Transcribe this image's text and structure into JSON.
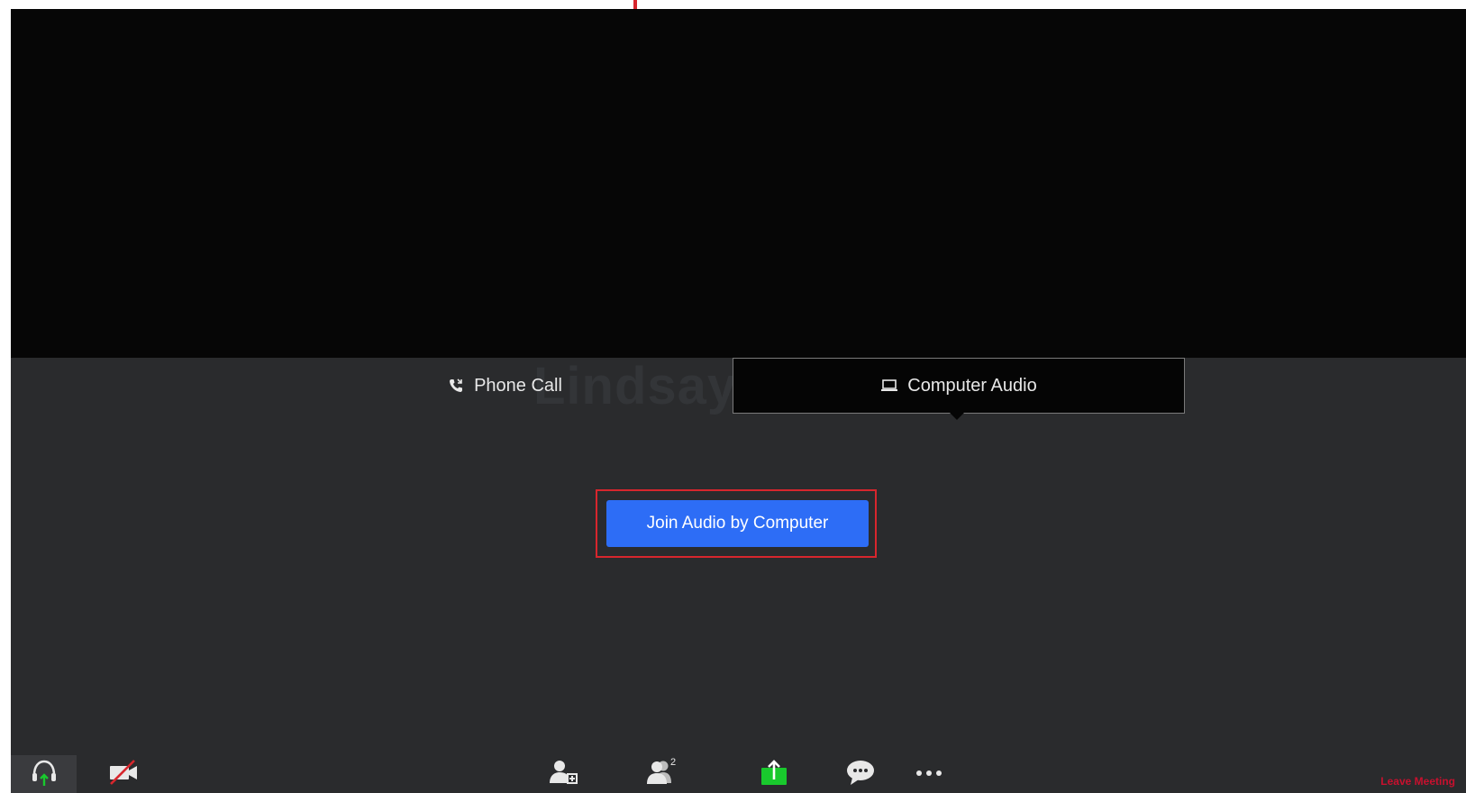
{
  "participant": {
    "name": "Lindsay"
  },
  "audio_tabs": {
    "phone_label": "Phone Call",
    "computer_label": "Computer Audio",
    "selected": "Computer Audio"
  },
  "join_button": {
    "label": "Join Audio by Computer"
  },
  "toolbar": {
    "participants_count": "2",
    "leave_label": "Leave Meeting"
  },
  "colors": {
    "accent": "#2d6df6",
    "highlight": "#d7262d",
    "share_green": "#19c92d",
    "leave_red": "#c8102e",
    "background": "#2a2b2d",
    "video_bg": "#060606"
  },
  "icons": {
    "audio": "headphone-icon",
    "video": "video-off-icon",
    "invite": "invite-icon",
    "participants": "participants-icon",
    "share": "share-screen-icon",
    "chat": "chat-icon",
    "more": "more-icon",
    "phone": "phone-icon",
    "computer": "laptop-icon"
  }
}
